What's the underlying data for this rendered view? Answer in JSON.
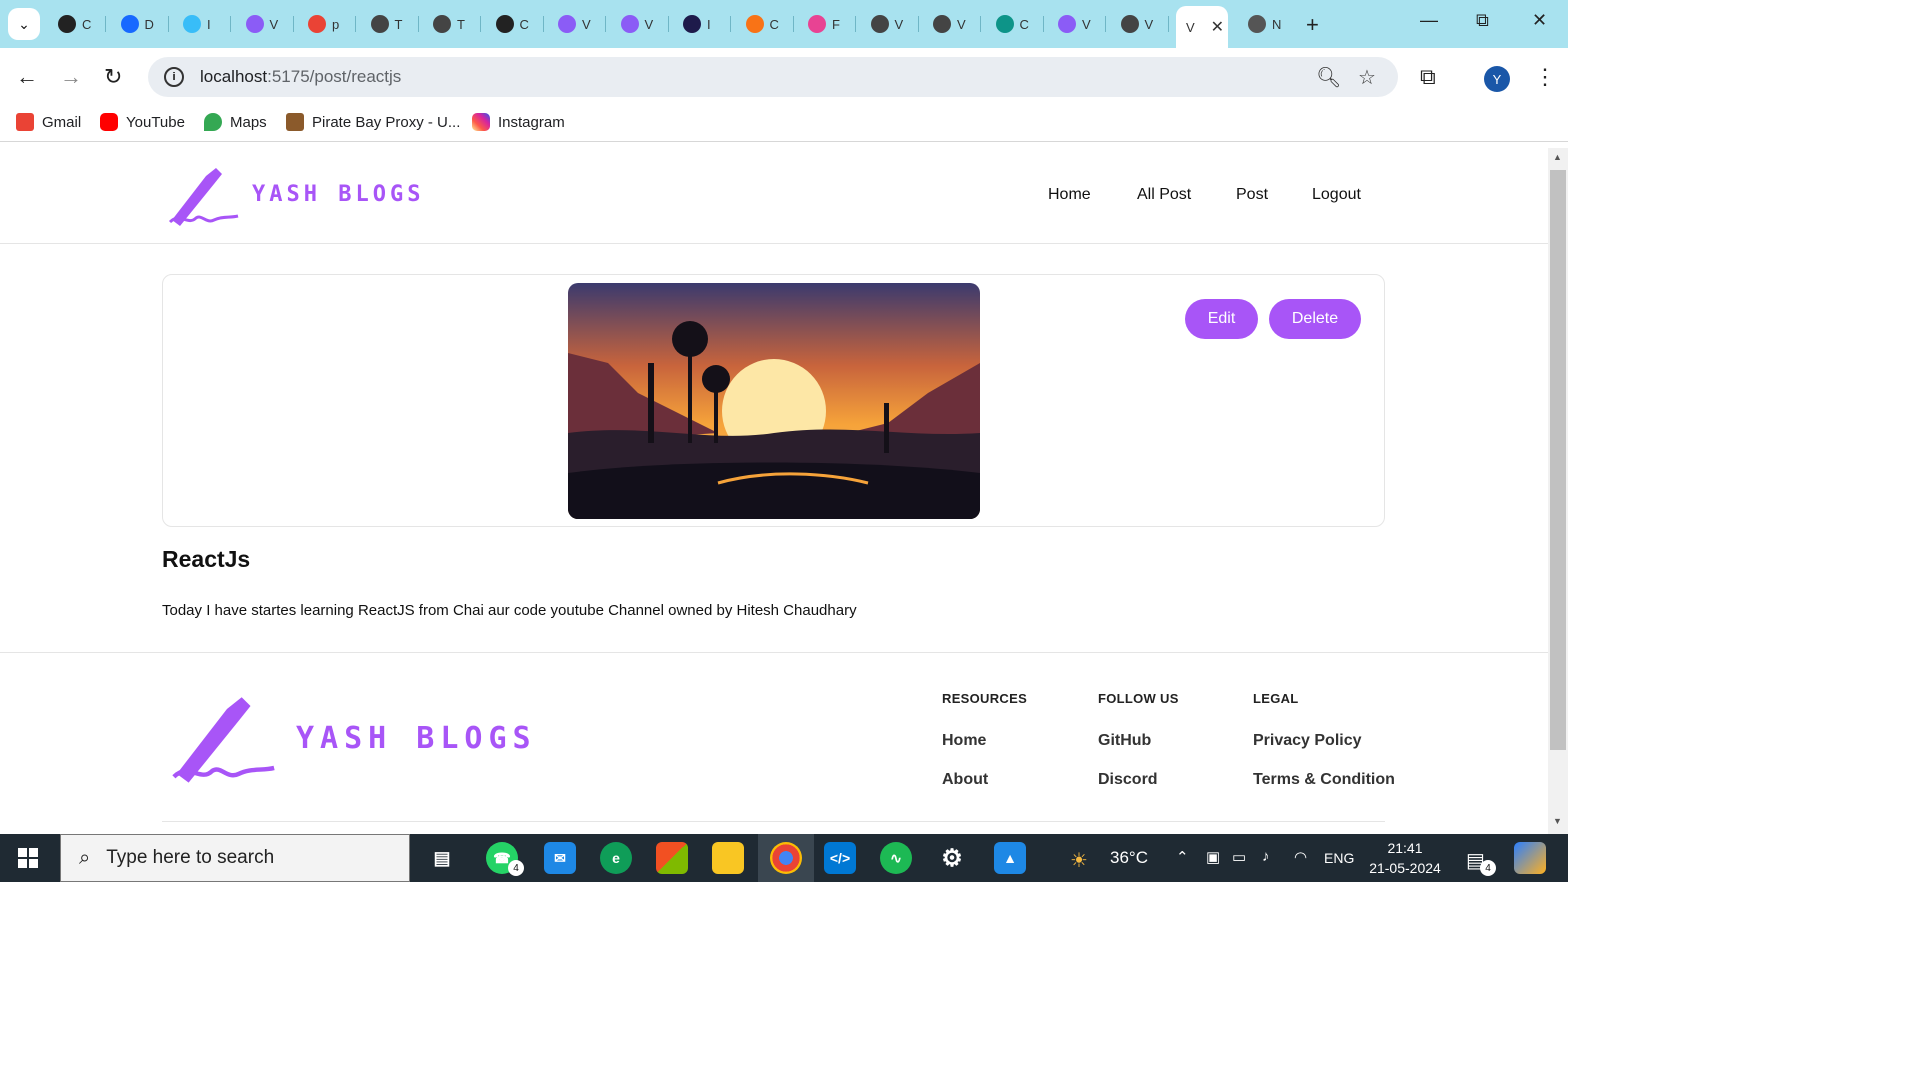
{
  "browser": {
    "tabs": [
      {
        "icon": "openai-icon",
        "label": "C",
        "color": "#222"
      },
      {
        "icon": "behance-icon",
        "label": "D",
        "color": "#1769ff"
      },
      {
        "icon": "tailwind-icon",
        "label": "I",
        "color": "#38bdf8"
      },
      {
        "icon": "vite-icon",
        "label": "V",
        "color": "#8b5cf6"
      },
      {
        "icon": "google-icon",
        "label": "p",
        "color": "#ea4335"
      },
      {
        "icon": "layers-icon",
        "label": "T",
        "color": "#444"
      },
      {
        "icon": "layers-icon",
        "label": "T",
        "color": "#444"
      },
      {
        "icon": "openai-icon",
        "label": "C",
        "color": "#222"
      },
      {
        "icon": "vite-icon",
        "label": "V",
        "color": "#8b5cf6"
      },
      {
        "icon": "vite-icon",
        "label": "V",
        "color": "#8b5cf6"
      },
      {
        "icon": "p-icon",
        "label": "I",
        "color": "#1e1b4b"
      },
      {
        "icon": "copilot-icon",
        "label": "C",
        "color": "#f97316"
      },
      {
        "icon": "react-icon",
        "label": "F",
        "color": "#e84393"
      },
      {
        "icon": "globe-icon",
        "label": "V",
        "color": "#444"
      },
      {
        "icon": "globe-icon",
        "label": "V",
        "color": "#444"
      },
      {
        "icon": "diamond-icon",
        "label": "C",
        "color": "#0d9488"
      },
      {
        "icon": "vite-icon",
        "label": "V",
        "color": "#8b5cf6"
      },
      {
        "icon": "globe-icon",
        "label": "V",
        "color": "#444"
      }
    ],
    "active_tab_label": "V",
    "last_tab_label": "N",
    "url_host": "localhost",
    "url_path": ":5175/post/reactjs",
    "profile_initial": "Y",
    "bookmarks": [
      {
        "label": "Gmail",
        "icon": "gmail-icon",
        "color": "#ea4335"
      },
      {
        "label": "YouTube",
        "icon": "youtube-icon",
        "color": "#ff0000"
      },
      {
        "label": "Maps",
        "icon": "maps-icon",
        "color": "#34a853"
      },
      {
        "label": "Pirate Bay Proxy - U...",
        "icon": "pirate-ship-icon",
        "color": "#8b5a2b"
      },
      {
        "label": "Instagram",
        "icon": "instagram-icon",
        "color": "#d6249f"
      }
    ]
  },
  "site": {
    "brand": "YASH BLOGS",
    "brand_color": "#a855f7",
    "nav": [
      "Home",
      "All Post",
      "Post",
      "Logout"
    ],
    "actions": {
      "edit": "Edit",
      "delete": "Delete"
    },
    "post": {
      "title": "ReactJs",
      "content": "Today I have startes learning ReactJS from Chai aur code youtube Channel owned by Hitesh Chaudhary"
    },
    "footer": {
      "columns": [
        {
          "title": "RESOURCES",
          "links": [
            "Home",
            "About"
          ]
        },
        {
          "title": "FOLLOW US",
          "links": [
            "GitHub",
            "Discord"
          ]
        },
        {
          "title": "LEGAL",
          "links": [
            "Privacy Policy",
            "Terms & Condition"
          ]
        }
      ]
    }
  },
  "taskbar": {
    "search_placeholder": "Type here to search",
    "whatsapp_badge": "4",
    "weather": "36°C",
    "language": "ENG",
    "time": "21:41",
    "date": "21-05-2024",
    "notification_badge": "4"
  }
}
